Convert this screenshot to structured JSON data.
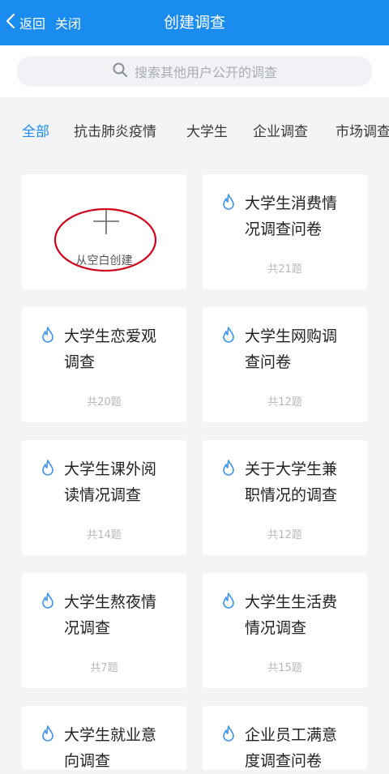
{
  "header": {
    "back_label": "返回",
    "close_label": "关闭",
    "title": "创建调查"
  },
  "search": {
    "placeholder": "搜索其他用户公开的调查"
  },
  "tabs": [
    {
      "label": "全部",
      "active": true
    },
    {
      "label": "抗击肺炎疫情",
      "active": false
    },
    {
      "label": "大学生",
      "active": false
    },
    {
      "label": "企业调查",
      "active": false
    },
    {
      "label": "市场调查",
      "active": false
    }
  ],
  "blank_card": {
    "label": "从空白创建"
  },
  "templates": [
    {
      "title": "大学生消费情况调查问卷",
      "count": "共21题"
    },
    {
      "title": "大学生恋爱观调查",
      "count": "共20题"
    },
    {
      "title": "大学生网购调查问卷",
      "count": "共12题"
    },
    {
      "title": "大学生课外阅读情况调查",
      "count": "共14题"
    },
    {
      "title": "关于大学生兼职情况的调查",
      "count": "共12题"
    },
    {
      "title": "大学生熬夜情况调查",
      "count": "共7题"
    },
    {
      "title": "大学生生活费情况调查",
      "count": "共15题"
    },
    {
      "title": "大学生就业意向调查",
      "count": ""
    },
    {
      "title": "企业员工满意度调查问卷",
      "count": ""
    }
  ],
  "colors": {
    "accent": "#1a8cf0",
    "annotation_ring": "#d0021b"
  },
  "icons": {
    "back": "chevron-left-icon",
    "search": "search-icon",
    "hot": "flame-icon",
    "add": "plus-icon"
  }
}
